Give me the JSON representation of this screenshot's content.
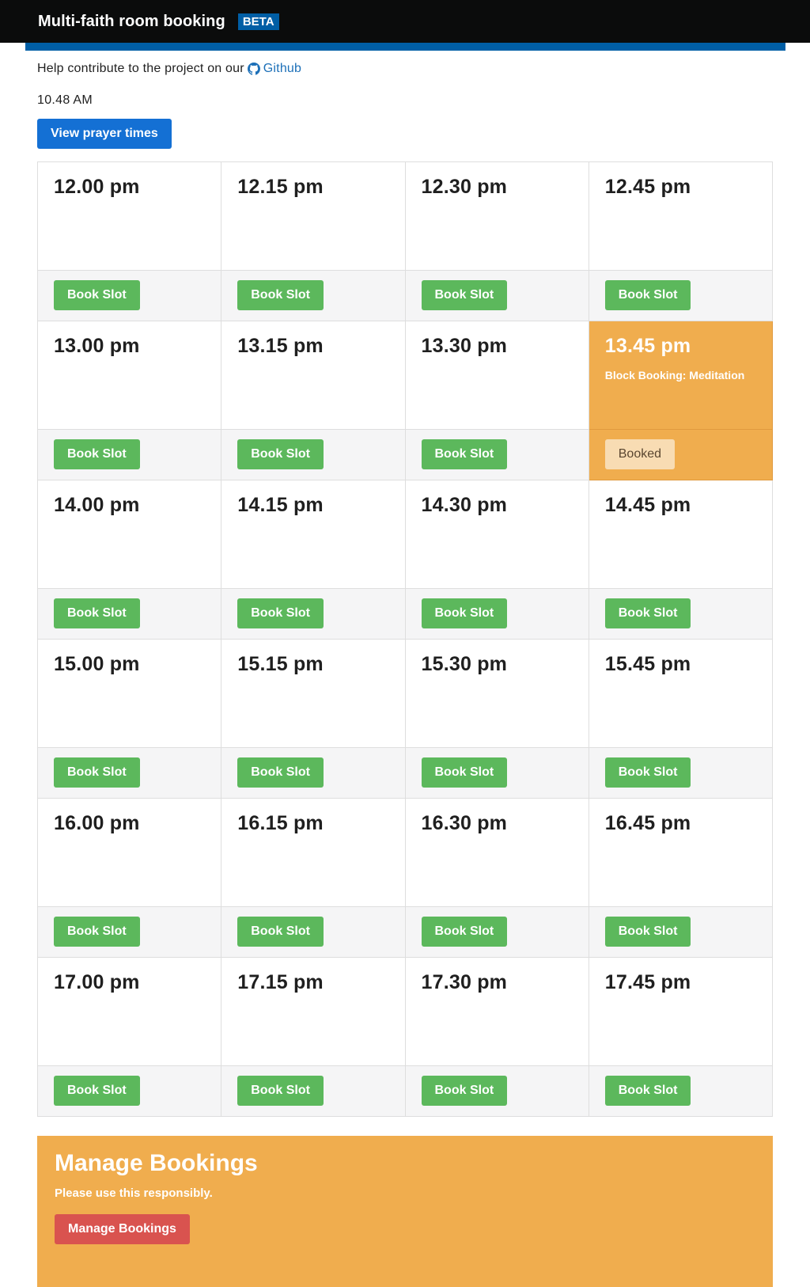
{
  "header": {
    "title": "Multi-faith room booking",
    "badge": "BETA"
  },
  "github_line": {
    "text": "Help contribute to the project on our",
    "link_label": "Github",
    "icon": "github-icon"
  },
  "clock": "10.48 AM",
  "prayer_button": "View prayer times",
  "colors": {
    "header_bg": "#0b0c0c",
    "accent_blue": "#005ea5",
    "book_green": "#5cb85c",
    "booked_orange": "#f0ad4e",
    "manage_red": "#d9534f"
  },
  "slots": [
    {
      "time": "12.00 pm",
      "note": "",
      "action": "Book Slot",
      "booked": false
    },
    {
      "time": "12.15 pm",
      "note": "",
      "action": "Book Slot",
      "booked": false
    },
    {
      "time": "12.30 pm",
      "note": "",
      "action": "Book Slot",
      "booked": false
    },
    {
      "time": "12.45 pm",
      "note": "",
      "action": "Book Slot",
      "booked": false
    },
    {
      "time": "13.00 pm",
      "note": "",
      "action": "Book Slot",
      "booked": false
    },
    {
      "time": "13.15 pm",
      "note": "",
      "action": "Book Slot",
      "booked": false
    },
    {
      "time": "13.30 pm",
      "note": "",
      "action": "Book Slot",
      "booked": false
    },
    {
      "time": "13.45 pm",
      "note": "Block Booking: Meditation",
      "action": "Booked",
      "booked": true
    },
    {
      "time": "14.00 pm",
      "note": "",
      "action": "Book Slot",
      "booked": false
    },
    {
      "time": "14.15 pm",
      "note": "",
      "action": "Book Slot",
      "booked": false
    },
    {
      "time": "14.30 pm",
      "note": "",
      "action": "Book Slot",
      "booked": false
    },
    {
      "time": "14.45 pm",
      "note": "",
      "action": "Book Slot",
      "booked": false
    },
    {
      "time": "15.00 pm",
      "note": "",
      "action": "Book Slot",
      "booked": false
    },
    {
      "time": "15.15 pm",
      "note": "",
      "action": "Book Slot",
      "booked": false
    },
    {
      "time": "15.30 pm",
      "note": "",
      "action": "Book Slot",
      "booked": false
    },
    {
      "time": "15.45 pm",
      "note": "",
      "action": "Book Slot",
      "booked": false
    },
    {
      "time": "16.00 pm",
      "note": "",
      "action": "Book Slot",
      "booked": false
    },
    {
      "time": "16.15 pm",
      "note": "",
      "action": "Book Slot",
      "booked": false
    },
    {
      "time": "16.30 pm",
      "note": "",
      "action": "Book Slot",
      "booked": false
    },
    {
      "time": "16.45 pm",
      "note": "",
      "action": "Book Slot",
      "booked": false
    },
    {
      "time": "17.00 pm",
      "note": "",
      "action": "Book Slot",
      "booked": false
    },
    {
      "time": "17.15 pm",
      "note": "",
      "action": "Book Slot",
      "booked": false
    },
    {
      "time": "17.30 pm",
      "note": "",
      "action": "Book Slot",
      "booked": false
    },
    {
      "time": "17.45 pm",
      "note": "",
      "action": "Book Slot",
      "booked": false
    }
  ],
  "manage": {
    "title": "Manage Bookings",
    "subtitle": "Please use this responsibly.",
    "button": "Manage Bookings"
  }
}
